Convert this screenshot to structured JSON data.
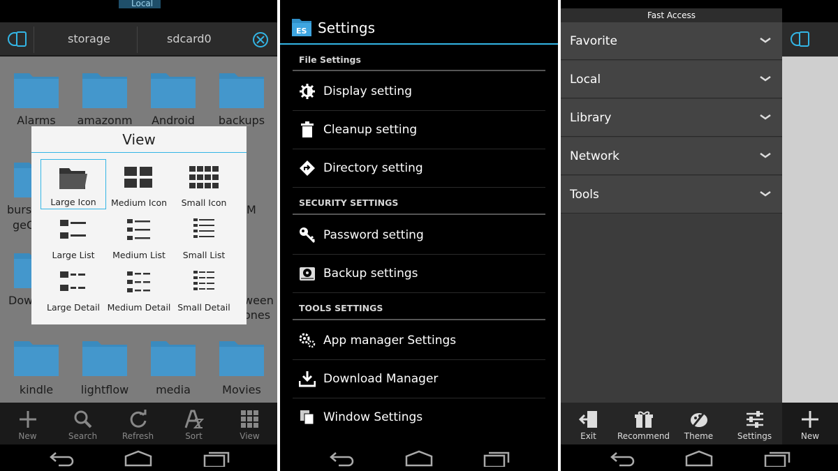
{
  "panel1": {
    "status": {
      "local": "Local"
    },
    "path": [
      "storage",
      "sdcard0"
    ],
    "folders_top": [
      "Alarms",
      "amazonm",
      "Android",
      "backups"
    ],
    "folders_partial": {
      "left_row2": "burs",
      "left_row2b": "geC",
      "right_row2": "M",
      "left_row3": "Dow",
      "right_row3": "ween",
      "right_row3b": "ones"
    },
    "folders_bottom": [
      "kindle",
      "lightflow",
      "media",
      "Movies"
    ],
    "dialog": {
      "title": "View",
      "options": [
        "Large Icon",
        "Medium Icon",
        "Small Icon",
        "Large List",
        "Medium List",
        "Small List",
        "Large Detail",
        "Medium Detail",
        "Small Detail"
      ],
      "selected": "Large Icon"
    },
    "toolbar": [
      "New",
      "Search",
      "Refresh",
      "Sort",
      "View"
    ]
  },
  "panel2": {
    "title": "Settings",
    "sections": [
      {
        "header": "File Settings",
        "items": [
          {
            "label": "Display setting",
            "icon": "gear-icon"
          },
          {
            "label": "Cleanup setting",
            "icon": "trash-icon"
          },
          {
            "label": "Directory setting",
            "icon": "directory-icon"
          }
        ]
      },
      {
        "header": "SECURITY SETTINGS",
        "items": [
          {
            "label": "Password setting",
            "icon": "key-icon"
          },
          {
            "label": "Backup settings",
            "icon": "backup-icon"
          }
        ]
      },
      {
        "header": "TOOLS SETTINGS",
        "items": [
          {
            "label": "App manager Settings",
            "icon": "app-manager-icon"
          },
          {
            "label": "Download Manager",
            "icon": "download-icon"
          },
          {
            "label": "Window Settings",
            "icon": "window-icon"
          }
        ]
      }
    ]
  },
  "panel3": {
    "title": "Fast Access",
    "items": [
      "Favorite",
      "Local",
      "Library",
      "Network",
      "Tools"
    ],
    "toolbar": [
      "Exit",
      "Recommend",
      "Theme",
      "Settings"
    ],
    "new_label": "New"
  },
  "colors": {
    "accent": "#33b5e5",
    "folder": "#3a8bbf"
  }
}
